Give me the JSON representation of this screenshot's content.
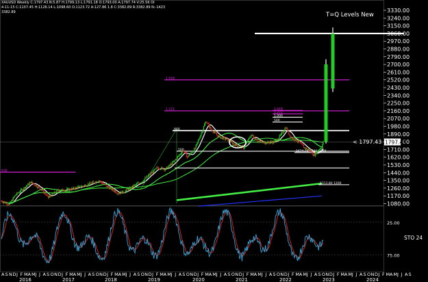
{
  "header": {
    "line1": "XAUUSD Weekly  C:1797.43  N:5.87  H:1799.13  L:1791.18  O:1793.00  A:1797.74  V:25.5K  OI",
    "line2": "4-11-15  C:1107.45  H:1126.14  L:1098.60  O:1123.72  A:127.86 1.8  C:3382.89  R:3382.89  N:-1423",
    "line3": "3382.89"
  },
  "colors": {
    "background": "#000000",
    "bull": "#22cc22",
    "bear": "#dd2222",
    "level_white": "#ffffff",
    "level_magenta": "#e020e0",
    "ma_green": "#44ee44",
    "ma_white": "#ffffff",
    "ma_blue": "#2233ff",
    "osc_cyan": "#33aadd",
    "osc_red": "#ee2222"
  },
  "chart_data": {
    "type": "candlestick",
    "title": "",
    "annotation_main": "T=Q Levels New",
    "price_label": "< 1797.43",
    "price_box": "1797.43",
    "y_ticks": [
      "3330.00",
      "3240.00",
      "3150.00",
      "3060.00",
      "2970.00",
      "2880.00",
      "2790.00",
      "2700.00",
      "2610.00",
      "2520.00",
      "2430.00",
      "2340.00",
      "2250.00",
      "2160.00",
      "2070.00",
      "1980.00",
      "1890.00",
      "1800.00",
      "1710.00",
      "1620.00",
      "1530.00",
      "1440.00",
      "1350.00",
      "1260.00",
      "1170.00",
      "1080.00"
    ],
    "ylim": [
      1060,
      3370
    ],
    "x_month_labels": [
      "A",
      "S",
      "N",
      "D",
      "J",
      "F",
      "M",
      "A",
      "M",
      "J",
      "J",
      "A",
      "S",
      "O",
      "N",
      "D",
      "J",
      "F",
      "M",
      "A",
      "M",
      "J",
      "J",
      "A",
      "S",
      "O",
      "N",
      "D",
      "J",
      "F",
      "M",
      "A",
      "M",
      "J",
      "J",
      "A",
      "S",
      "O",
      "N",
      "D",
      "J",
      "F",
      "M",
      "A",
      "M",
      "J",
      "J",
      "A",
      "S",
      "O",
      "N",
      "D",
      "J",
      "F",
      "M",
      "A",
      "M",
      "J",
      "J",
      "A",
      "S",
      "O",
      "N",
      "D",
      "J",
      "F",
      "M",
      "A",
      "M",
      "J",
      "J",
      "A",
      "S",
      "O",
      "N",
      "D",
      "J",
      "F",
      "M",
      "A",
      "M",
      "J",
      "J",
      "A",
      "S",
      "O",
      "N",
      "D",
      "J",
      "F",
      "M",
      "A",
      "M",
      "J",
      "J",
      "A",
      "S",
      "O",
      "N",
      "D",
      "J",
      "F",
      "M",
      "A",
      "M",
      "J",
      "J",
      "A",
      "S"
    ],
    "x_year_labels": [
      "2016",
      "2017",
      "2018",
      "2019",
      "2020",
      "2021",
      "2022",
      "2023",
      "2024"
    ],
    "level_lines": [
      {
        "label": "",
        "value": 3060,
        "color": "#ffffff"
      },
      {
        "label": "1.618",
        "value": 2520,
        "color": "#e020e0"
      },
      {
        "label": "1.272",
        "value": 2160,
        "color": "#e020e0"
      },
      {
        "label": "1.618",
        "value": 2165,
        "color": "#e020e0"
      },
      {
        "label": "1.272",
        "value": 2125,
        "color": "#e020e0"
      },
      {
        "label": "1.000",
        "value": 2085,
        "color": "#ffffff"
      },
      {
        "label": "500",
        "value": 2030,
        "color": "#ffffff"
      },
      {
        "label": "900",
        "value": 1930,
        "color": "#ffffff"
      },
      {
        "label": "500",
        "value": 1690,
        "color": "#ffffff"
      },
      {
        "label": "1674.70  1660.1000",
        "value": 1675,
        "color": "#ffffff"
      },
      {
        "label": "",
        "value": 1495,
        "color": "#ffffff"
      },
      {
        "label": "618",
        "value": 1447,
        "color": "#e020e0"
      },
      {
        "label": "1313.80  1200",
        "value": 1300,
        "color": "#ffffff"
      }
    ],
    "oscillator": {
      "label": "STO 24",
      "ticks": [
        "25.00",
        "75.00"
      ],
      "ylim": [
        0,
        100
      ]
    }
  }
}
